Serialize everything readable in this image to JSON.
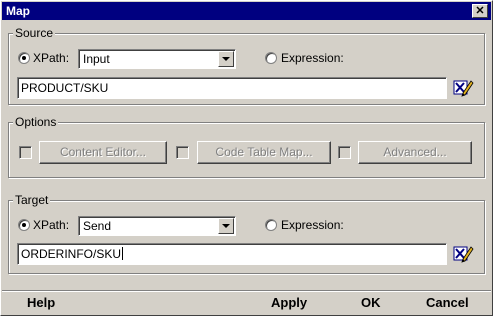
{
  "window": {
    "title": "Map",
    "close_glyph": "✕"
  },
  "source": {
    "legend": "Source",
    "xpath_label": "XPath:",
    "xpath_selected": true,
    "xpath_value": "Input",
    "expression_label": "Expression:",
    "path_value": "PRODUCT/SKU",
    "editor_icon": "xpath-editor-icon"
  },
  "options": {
    "legend": "Options",
    "buttons": [
      {
        "label": "Content Editor...",
        "checked": false,
        "enabled": false
      },
      {
        "label": "Code Table Map...",
        "checked": false,
        "enabled": false
      },
      {
        "label": "Advanced...",
        "checked": false,
        "enabled": false
      }
    ]
  },
  "target": {
    "legend": "Target",
    "xpath_label": "XPath:",
    "xpath_selected": true,
    "xpath_value": "Send",
    "expression_label": "Expression:",
    "path_value": "ORDERINFO/SKU",
    "editor_icon": "xpath-editor-icon"
  },
  "bottom_bar": {
    "help": "Help",
    "apply": "Apply",
    "ok": "OK",
    "cancel": "Cancel"
  },
  "colors": {
    "titlebar": "#000080",
    "face": "#d4d0c8"
  }
}
